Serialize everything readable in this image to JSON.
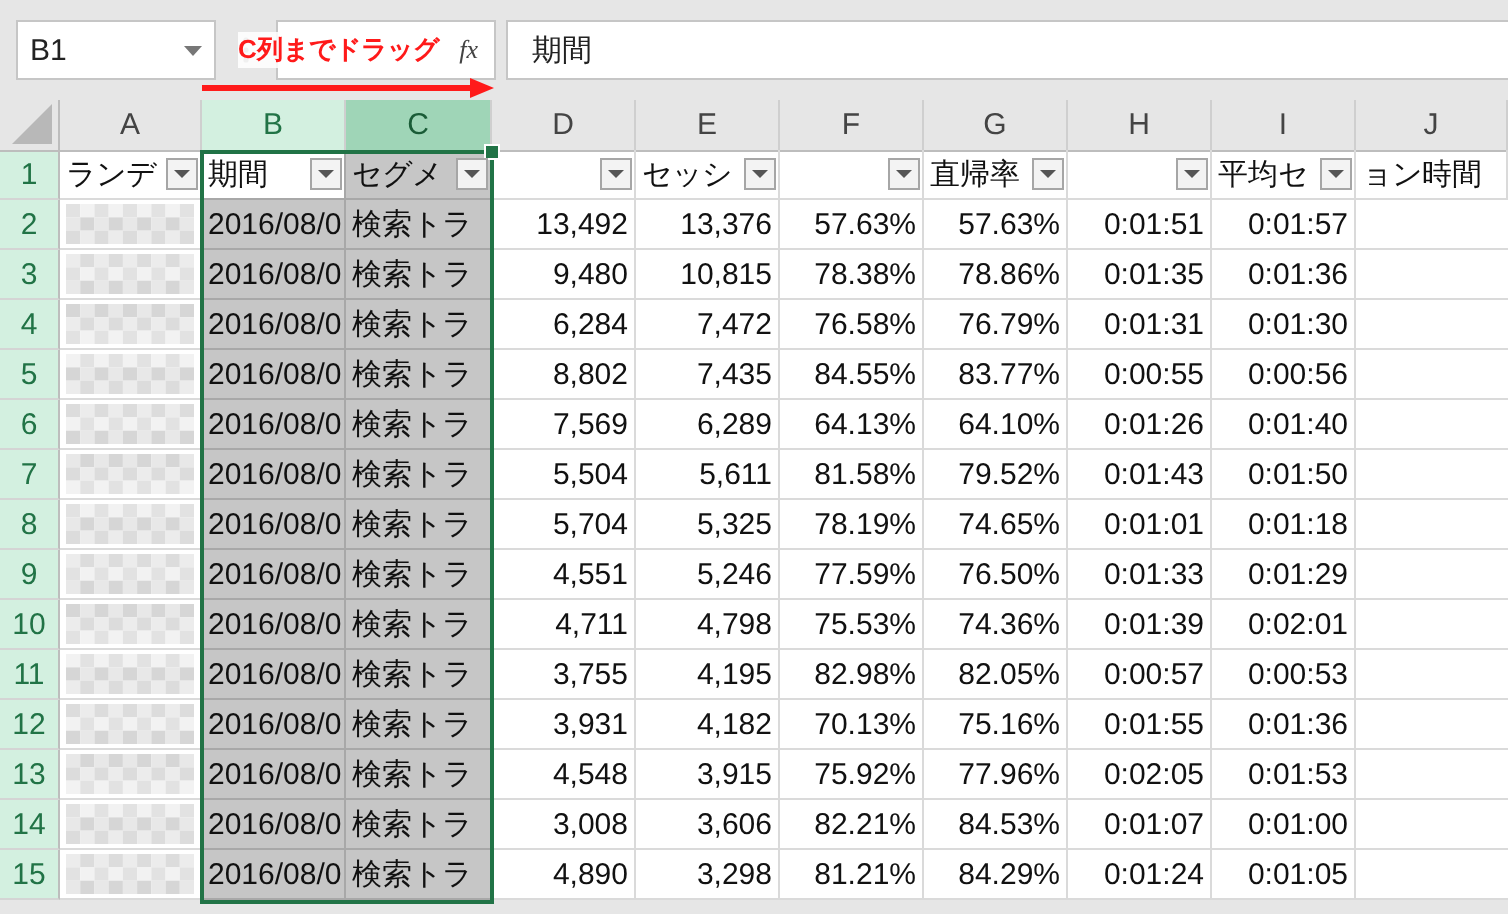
{
  "name_box": "B1",
  "function_label": "fx",
  "formula_value": "期間",
  "annotation": {
    "text": "C列までドラッグ"
  },
  "columns": [
    {
      "letter": "A",
      "selected": false
    },
    {
      "letter": "B",
      "selected": true
    },
    {
      "letter": "C",
      "selected": true
    },
    {
      "letter": "D",
      "selected": false
    },
    {
      "letter": "E",
      "selected": false
    },
    {
      "letter": "F",
      "selected": false
    },
    {
      "letter": "G",
      "selected": false
    },
    {
      "letter": "H",
      "selected": false
    },
    {
      "letter": "I",
      "selected": false
    },
    {
      "letter": "J",
      "selected": false
    }
  ],
  "header_row": {
    "number": "1",
    "selected": true,
    "cells": [
      {
        "text": "ランデ",
        "filter": true,
        "active": false
      },
      {
        "text": "期間",
        "filter": true,
        "active": true
      },
      {
        "text": "セグメ",
        "filter": true,
        "active": false
      },
      {
        "text": "",
        "filter": true,
        "active": false
      },
      {
        "text": "セッシ",
        "filter": true,
        "active": false
      },
      {
        "text": "",
        "filter": true,
        "active": false
      },
      {
        "text": "直帰率",
        "filter": true,
        "active": false
      },
      {
        "text": "",
        "filter": true,
        "active": false
      },
      {
        "text": "平均セ",
        "filter": true,
        "active": false
      },
      {
        "text": "ョン時間",
        "filter": false,
        "active": false
      }
    ]
  },
  "rows": [
    {
      "number": "2",
      "selected": true,
      "cells": [
        "2016/08/0",
        "検索トラ",
        "13,492",
        "13,376",
        "57.63%",
        "57.63%",
        "0:01:51",
        "0:01:57"
      ]
    },
    {
      "number": "3",
      "selected": true,
      "cells": [
        "2016/08/0",
        "検索トラ",
        "9,480",
        "10,815",
        "78.38%",
        "78.86%",
        "0:01:35",
        "0:01:36"
      ]
    },
    {
      "number": "4",
      "selected": true,
      "cells": [
        "2016/08/0",
        "検索トラ",
        "6,284",
        "7,472",
        "76.58%",
        "76.79%",
        "0:01:31",
        "0:01:30"
      ]
    },
    {
      "number": "5",
      "selected": true,
      "cells": [
        "2016/08/0",
        "検索トラ",
        "8,802",
        "7,435",
        "84.55%",
        "83.77%",
        "0:00:55",
        "0:00:56"
      ]
    },
    {
      "number": "6",
      "selected": true,
      "cells": [
        "2016/08/0",
        "検索トラ",
        "7,569",
        "6,289",
        "64.13%",
        "64.10%",
        "0:01:26",
        "0:01:40"
      ]
    },
    {
      "number": "7",
      "selected": true,
      "cells": [
        "2016/08/0",
        "検索トラ",
        "5,504",
        "5,611",
        "81.58%",
        "79.52%",
        "0:01:43",
        "0:01:50"
      ]
    },
    {
      "number": "8",
      "selected": true,
      "cells": [
        "2016/08/0",
        "検索トラ",
        "5,704",
        "5,325",
        "78.19%",
        "74.65%",
        "0:01:01",
        "0:01:18"
      ]
    },
    {
      "number": "9",
      "selected": true,
      "cells": [
        "2016/08/0",
        "検索トラ",
        "4,551",
        "5,246",
        "77.59%",
        "76.50%",
        "0:01:33",
        "0:01:29"
      ]
    },
    {
      "number": "10",
      "selected": true,
      "cells": [
        "2016/08/0",
        "検索トラ",
        "4,711",
        "4,798",
        "75.53%",
        "74.36%",
        "0:01:39",
        "0:02:01"
      ]
    },
    {
      "number": "11",
      "selected": true,
      "cells": [
        "2016/08/0",
        "検索トラ",
        "3,755",
        "4,195",
        "82.98%",
        "82.05%",
        "0:00:57",
        "0:00:53"
      ]
    },
    {
      "number": "12",
      "selected": true,
      "cells": [
        "2016/08/0",
        "検索トラ",
        "3,931",
        "4,182",
        "70.13%",
        "75.16%",
        "0:01:55",
        "0:01:36"
      ]
    },
    {
      "number": "13",
      "selected": true,
      "cells": [
        "2016/08/0",
        "検索トラ",
        "4,548",
        "3,915",
        "75.92%",
        "77.96%",
        "0:02:05",
        "0:01:53"
      ]
    },
    {
      "number": "14",
      "selected": true,
      "cells": [
        "2016/08/0",
        "検索トラ",
        "3,008",
        "3,606",
        "82.21%",
        "84.53%",
        "0:01:07",
        "0:01:00"
      ]
    },
    {
      "number": "15",
      "selected": true,
      "cells": [
        "2016/08/0",
        "検索トラ",
        "4,890",
        "3,298",
        "81.21%",
        "84.29%",
        "0:01:24",
        "0:01:05"
      ]
    }
  ]
}
